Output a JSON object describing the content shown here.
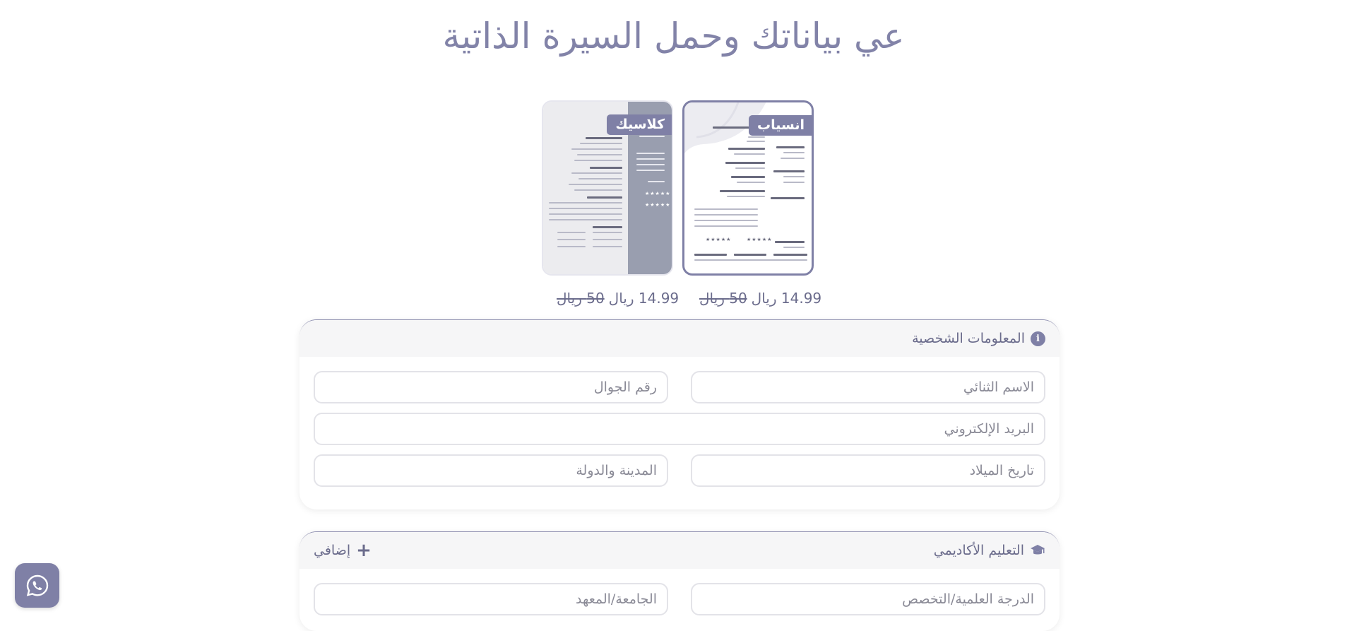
{
  "page": {
    "title": "عي بياناتك وحمل السيرة الذاتية"
  },
  "templates": [
    {
      "name": "انسياب",
      "price": "14.99 ريال",
      "old_price": "50 ريال",
      "selected": true
    },
    {
      "name": "كلاسيك",
      "price": "14.99 ريال",
      "old_price": "50 ريال",
      "selected": false
    }
  ],
  "personal": {
    "title": "المعلومات الشخصية",
    "icon": "info-icon",
    "fields": {
      "second_name": "الاسم الثنائي",
      "phone": "رقم الجوال",
      "email": "البريد الإلكتروني",
      "birthdate": "تاريخ الميلاد",
      "city_country": "المدينة والدولة"
    }
  },
  "education": {
    "title": "التعليم الأكاديمي",
    "icon": "graduation-cap-icon",
    "add_label": "إضافي",
    "fields": {
      "degree": "الدرجة العلمية/التخصص",
      "university": "الجامعة/المعهد"
    }
  },
  "whatsapp": {
    "icon": "whatsapp-icon"
  },
  "colors": {
    "accent": "#7f80a6",
    "text": "#6b6c8c",
    "title": "#8283a8",
    "section_header_bg": "#f6f6f7"
  }
}
